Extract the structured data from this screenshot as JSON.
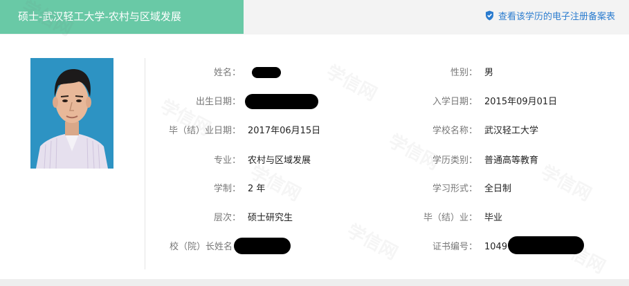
{
  "header": {
    "title": "硕士-武汉轻工大学-农村与区域发展",
    "verify_link": "查看该学历的电子注册备案表"
  },
  "watermark": "学信网",
  "fields_left": [
    {
      "label": "姓名：",
      "value": ""
    },
    {
      "label": "出生日期：",
      "value": ""
    },
    {
      "label": "毕（结）业日期：",
      "value": "2017年06月15日"
    },
    {
      "label": "专业：",
      "value": "农村与区域发展"
    },
    {
      "label": "学制：",
      "value": "2 年"
    },
    {
      "label": "层次：",
      "value": "硕士研究生"
    },
    {
      "label": "校（院）长姓名",
      "value": ""
    }
  ],
  "fields_right": [
    {
      "label": "性别：",
      "value": "男"
    },
    {
      "label": "入学日期：",
      "value": "2015年09月01日"
    },
    {
      "label": "学校名称：",
      "value": "武汉轻工大学"
    },
    {
      "label": "学历类别：",
      "value": "普通高等教育"
    },
    {
      "label": "学习形式：",
      "value": "全日制"
    },
    {
      "label": "毕（结）业：",
      "value": "毕业"
    },
    {
      "label": "证书编号：",
      "value": "1049 6                              17"
    }
  ],
  "colors": {
    "title_bg": "#69c9a6",
    "link": "#2b7ccf"
  }
}
